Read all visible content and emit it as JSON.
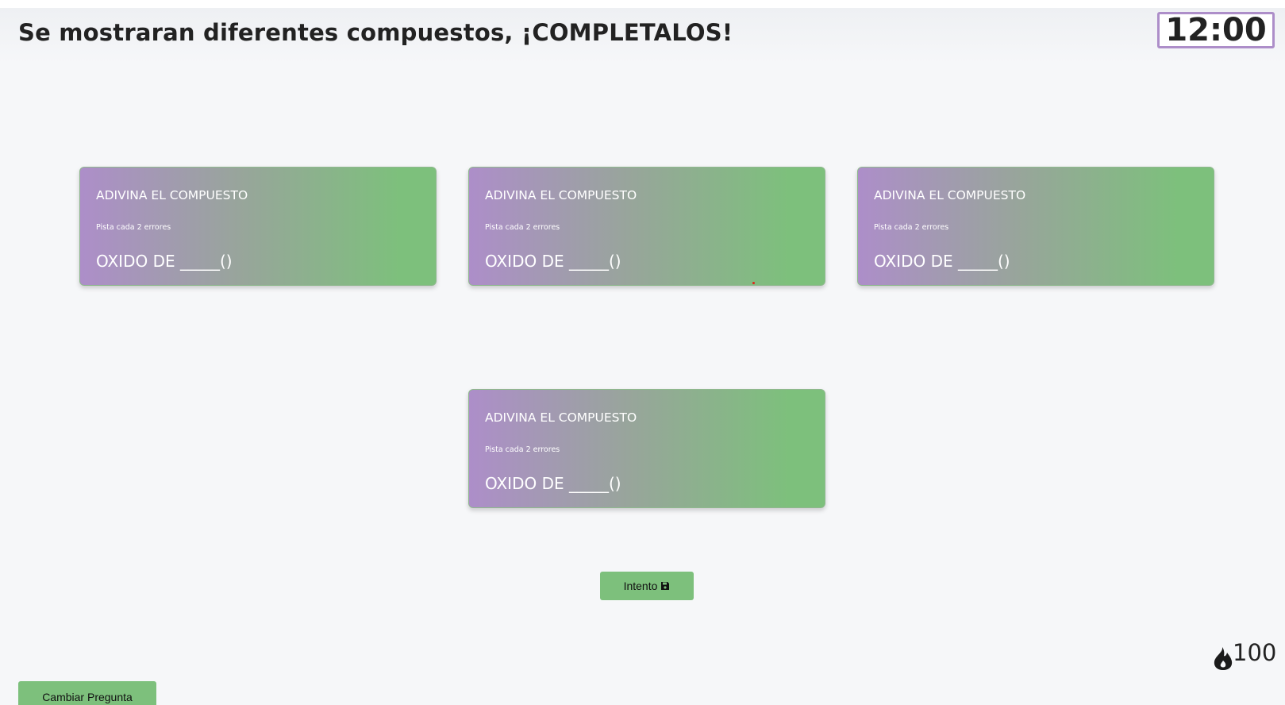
{
  "header": {
    "title": "Se mostraran diferentes compuestos, ¡COMPLETALOS!",
    "timer": "12:00"
  },
  "cards": [
    {
      "title": "ADIVINA EL COMPUESTO",
      "hint": "Pista cada 2 errores",
      "question": "OXIDO DE _____()"
    },
    {
      "title": "ADIVINA EL COMPUESTO",
      "hint": "Pista cada 2 errores",
      "question": "OXIDO DE _____()"
    },
    {
      "title": "ADIVINA EL COMPUESTO",
      "hint": "Pista cada 2 errores",
      "question": "OXIDO DE _____()"
    },
    {
      "title": "ADIVINA EL COMPUESTO",
      "hint": "Pista cada 2 errores",
      "question": "OXIDO DE _____()"
    }
  ],
  "actions": {
    "attempt_label": "Intento",
    "attempt_icon": "save-icon",
    "change_label": "Cambiar Pregunta"
  },
  "score": {
    "icon": "fire-icon",
    "value": "100"
  },
  "colors": {
    "accent_purple": "#ad8ec9",
    "accent_green": "#7dc07c",
    "background": "#f6f7f9",
    "text_dark": "#222222"
  }
}
